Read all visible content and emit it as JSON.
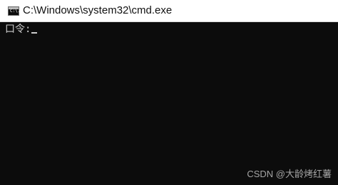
{
  "window": {
    "title": "C:\\Windows\\system32\\cmd.exe",
    "icon": "console-icon",
    "icon_label": "C:\\."
  },
  "console": {
    "prompt_text": "口令:",
    "background_color": "#0c0c0c",
    "text_color": "#cccccc"
  },
  "watermark": {
    "text": "CSDN @大龄烤红薯"
  }
}
